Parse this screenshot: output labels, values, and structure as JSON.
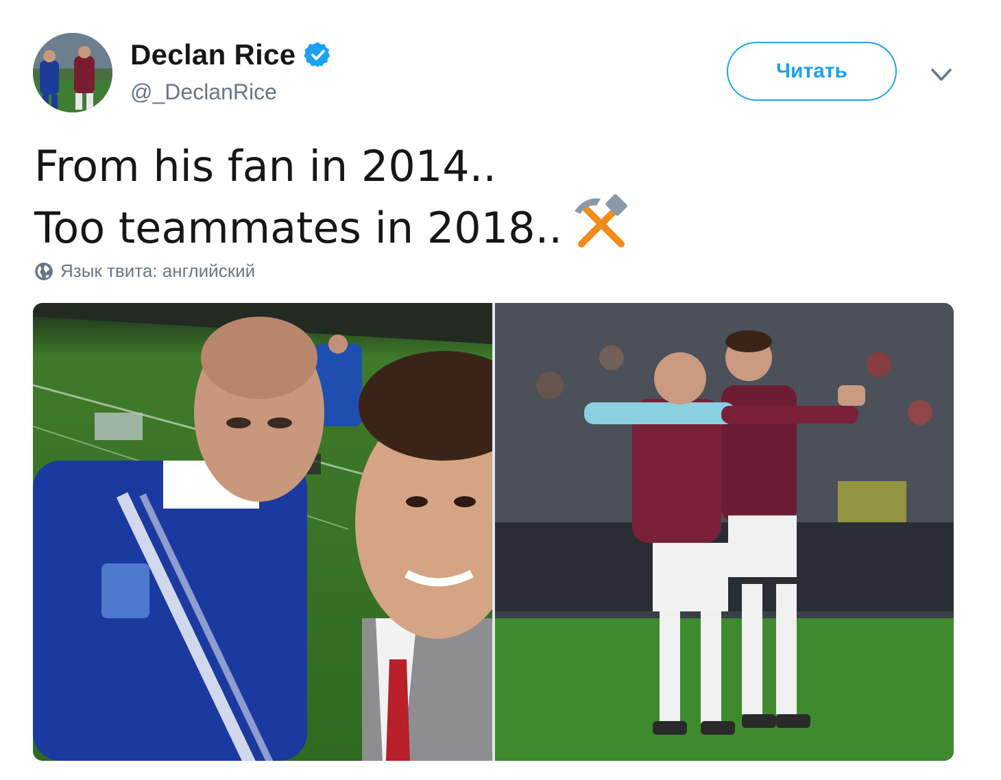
{
  "user": {
    "display_name": "Declan Rice",
    "handle": "@_DeclanRice",
    "verified": true,
    "avatar_icon": "avatar-photo"
  },
  "header": {
    "follow_label": "Читать",
    "menu_icon": "chevron-down-icon"
  },
  "tweet": {
    "line1": "From his fan in 2014..",
    "line2": "Too teammates in 2018..",
    "emoji_icon": "hammer-and-pick-icon"
  },
  "translation": {
    "label": "Язык твита: английский",
    "icon": "globe-icon"
  },
  "media": {
    "photos": [
      {
        "name": "selfie-2014-photo"
      },
      {
        "name": "teammates-2018-photo"
      }
    ]
  },
  "colors": {
    "accent": "#1da1f2",
    "text": "#14171a",
    "secondary": "#657786"
  }
}
